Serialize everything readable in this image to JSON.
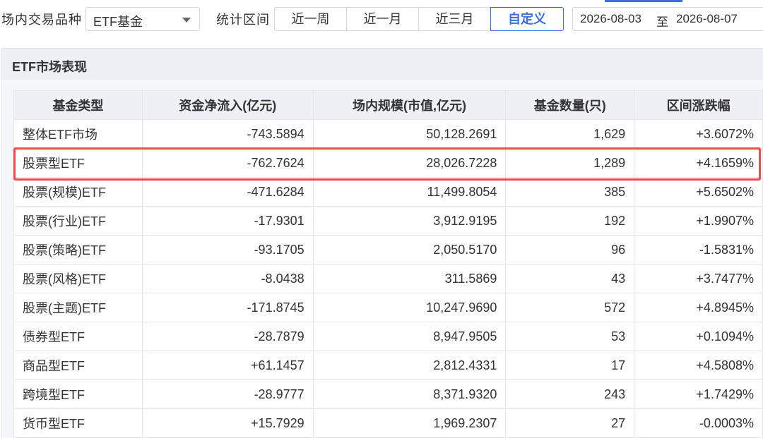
{
  "toolbar": {
    "type_label": "场内交易品种",
    "type_value": "ETF基金",
    "range_label": "统计区间",
    "periods": [
      "近一周",
      "近一月",
      "近三月",
      "自定义"
    ],
    "active_period_index": 3,
    "date_start": "2026-08-03",
    "date_sep": "至",
    "date_end": "2026-08-07"
  },
  "panel": {
    "title": "ETF市场表现"
  },
  "table": {
    "headers": [
      "基金类型",
      "资金净流入(亿元)",
      "场内规模(市值,亿元)",
      "基金数量(只)",
      "区间涨跌幅"
    ],
    "rows": [
      {
        "name": "整体ETF市场",
        "flow": "-743.5894",
        "scale": "50,128.2691",
        "count": "1,629",
        "change": "+3.6072%"
      },
      {
        "name": "股票型ETF",
        "flow": "-762.7624",
        "scale": "28,026.7228",
        "count": "1,289",
        "change": "+4.1659%"
      },
      {
        "name": "股票(规模)ETF",
        "flow": "-471.6284",
        "scale": "11,499.8054",
        "count": "385",
        "change": "+5.6502%"
      },
      {
        "name": "股票(行业)ETF",
        "flow": "-17.9301",
        "scale": "3,912.9195",
        "count": "192",
        "change": "+1.9907%"
      },
      {
        "name": "股票(策略)ETF",
        "flow": "-93.1705",
        "scale": "2,050.5170",
        "count": "96",
        "change": "-1.5831%"
      },
      {
        "name": "股票(风格)ETF",
        "flow": "-8.0438",
        "scale": "311.5869",
        "count": "43",
        "change": "+3.7477%"
      },
      {
        "name": "股票(主题)ETF",
        "flow": "-171.8745",
        "scale": "10,247.9690",
        "count": "572",
        "change": "+4.8945%"
      },
      {
        "name": "债券型ETF",
        "flow": "-28.7879",
        "scale": "8,947.9505",
        "count": "53",
        "change": "+0.1094%"
      },
      {
        "name": "商品型ETF",
        "flow": "+61.1457",
        "scale": "2,812.4331",
        "count": "17",
        "change": "+4.5808%"
      },
      {
        "name": "跨境型ETF",
        "flow": "-28.9777",
        "scale": "8,371.9320",
        "count": "243",
        "change": "+1.7429%"
      },
      {
        "name": "货币型ETF",
        "flow": "+15.7929",
        "scale": "1,969.2307",
        "count": "27",
        "change": "-0.0003%"
      }
    ],
    "highlighted_row_index": 1
  },
  "colors": {
    "positive": "#e23a3a",
    "negative": "#1f9a4e",
    "accent": "#3b6fe0",
    "highlight": "#ea4d4d"
  }
}
